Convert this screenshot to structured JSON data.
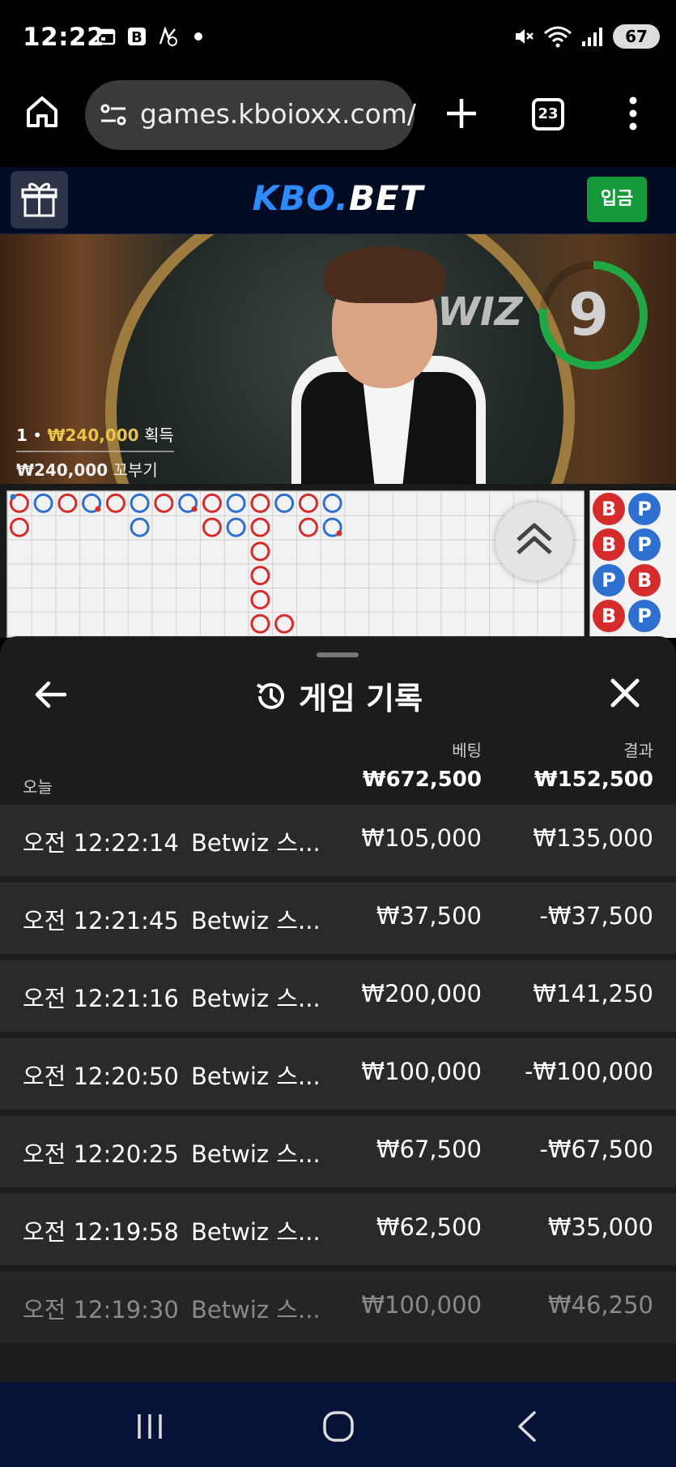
{
  "status_bar": {
    "time": "12:22",
    "battery": "67",
    "icons": [
      "calendar-icon",
      "b-app-icon",
      "no-access-icon",
      "notification-dot",
      "mute-icon",
      "wifi-icon",
      "signal-icon",
      "battery-icon"
    ]
  },
  "browser": {
    "url": "games.kboioxx.com/",
    "tab_count": "23"
  },
  "site": {
    "logo_part1": "KBO.",
    "logo_part2": "BET",
    "deposit_label": "입금"
  },
  "video": {
    "countdown": "9",
    "brand_overlay": "WIZ",
    "win_rank": "1",
    "win_amount": "₩240,000",
    "win_label": "획득",
    "tail_amount": "₩240,000",
    "tail_label": "꼬부기"
  },
  "roadmap": {
    "side_beads": [
      [
        "B",
        "P"
      ],
      [
        "B",
        "P"
      ],
      [
        "P",
        "B"
      ],
      [
        "B",
        "P"
      ]
    ]
  },
  "history": {
    "title": "게임 기록",
    "col_bet": "베팅",
    "col_result": "결과",
    "today_label": "오늘",
    "total_bet": "₩672,500",
    "total_result": "₩152,500",
    "rows": [
      {
        "time": "오전 12:22:14",
        "game": "Betwiz 스...",
        "bet": "₩105,000",
        "result": "₩135,000"
      },
      {
        "time": "오전 12:21:45",
        "game": "Betwiz 스...",
        "bet": "₩37,500",
        "result": "-₩37,500"
      },
      {
        "time": "오전 12:21:16",
        "game": "Betwiz 스...",
        "bet": "₩200,000",
        "result": "₩141,250"
      },
      {
        "time": "오전 12:20:50",
        "game": "Betwiz 스...",
        "bet": "₩100,000",
        "result": "-₩100,000"
      },
      {
        "time": "오전 12:20:25",
        "game": "Betwiz 스...",
        "bet": "₩67,500",
        "result": "-₩67,500"
      },
      {
        "time": "오전 12:19:58",
        "game": "Betwiz 스...",
        "bet": "₩62,500",
        "result": "₩35,000"
      },
      {
        "time": "오전 12:19:30",
        "game": "Betwiz 스...",
        "bet": "₩100,000",
        "result": "₩46,250"
      }
    ]
  },
  "colors": {
    "accent_blue": "#2d8bff",
    "deposit_green": "#149a3a",
    "win_gold": "#e8c44a",
    "timer_green": "#1fa843",
    "banker_red": "#d62b2b",
    "player_blue": "#2f6fd0"
  }
}
